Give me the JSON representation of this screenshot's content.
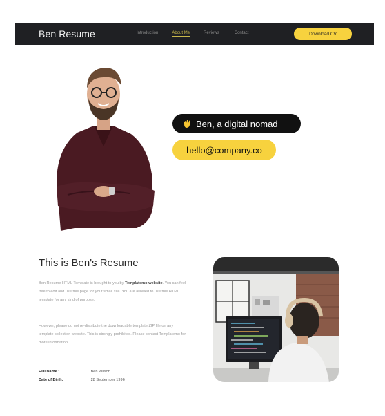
{
  "navbar": {
    "brand": "Ben Resume",
    "links": [
      "Introduction",
      "About Me",
      "Reviews",
      "Contact"
    ],
    "cta": "Download CV"
  },
  "hero": {
    "greeting": "Ben, a digital nomad",
    "email": "hello@company.co"
  },
  "about": {
    "title": "This is Ben's Resume",
    "p1_before": "Ben Resume HTML Template is brought to you by ",
    "p1_link": "Templatemo website",
    "p1_after": ". You can feel free to edit and use this page for your small site. You are allowed to use this HTML template for any kind of purpose.",
    "p2": "However, please do not re-distribute the downloadable template ZIP file on any template collection website. This is strongly prohibited. Please contact Templatemo for more information.",
    "info": [
      {
        "label": "Full Name :",
        "value": "Ben Wilson"
      },
      {
        "label": "Date of Birth:",
        "value": "28 September 1996"
      }
    ]
  },
  "colors": {
    "nav_bg": "#1f2023",
    "accent_yellow": "#f7d23e",
    "pill_dark": "#111111"
  },
  "icons": [
    "waving-hand-icon"
  ]
}
